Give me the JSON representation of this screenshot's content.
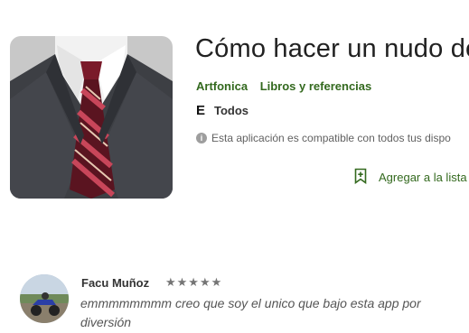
{
  "app": {
    "title": "Cómo hacer un nudo de",
    "developer": "Artfonica",
    "category": "Libros y referencias",
    "content_rating": "Todos",
    "compatibility": "Esta aplicación es compatible con todos tus dispo",
    "wishlist_label": "Agregar a la lista",
    "icons": {
      "app_icon": "suit-tie-icon",
      "rating_icon": "esrb-e-icon",
      "info_icon": "info-icon",
      "wishlist_icon": "bookmark-plus-icon"
    }
  },
  "review": {
    "author": "Facu Muñoz",
    "stars": 5,
    "stars_display": "★★★★★",
    "text": "emmmmmmmm creo que soy el unico que bajo esta app por diversión"
  },
  "colors": {
    "accent": "#33691e",
    "title": "#212121",
    "text_muted": "#616161"
  }
}
